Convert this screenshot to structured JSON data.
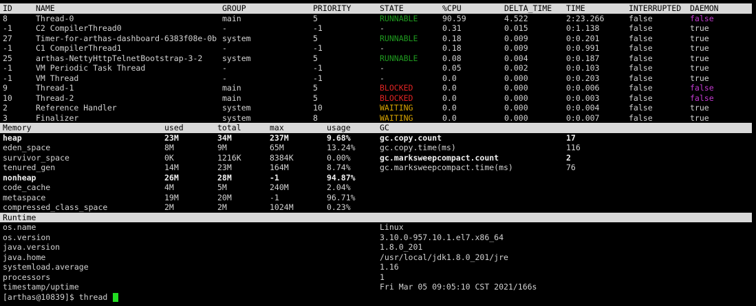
{
  "threads": {
    "columns": [
      "ID",
      "NAME",
      "GROUP",
      "PRIORITY",
      "STATE",
      "%CPU",
      "DELTA_TIME",
      "TIME",
      "INTERRUPTED",
      "DAEMON"
    ],
    "rows": [
      [
        "8",
        "Thread-0",
        "main",
        "5",
        "RUNNABLE",
        "90.59",
        "4.522",
        "2:23.266",
        "false",
        "false"
      ],
      [
        "-1",
        "C2 CompilerThread0",
        "-",
        "-1",
        "-",
        "0.31",
        "0.015",
        "0:1.138",
        "false",
        "true"
      ],
      [
        "27",
        "Timer-for-arthas-dashboard-6383f08e-0b",
        "system",
        "5",
        "RUNNABLE",
        "0.18",
        "0.009",
        "0:0.201",
        "false",
        "true"
      ],
      [
        "-1",
        "C1 CompilerThread1",
        "-",
        "-1",
        "-",
        "0.18",
        "0.009",
        "0:0.991",
        "false",
        "true"
      ],
      [
        "25",
        "arthas-NettyHttpTelnetBootstrap-3-2",
        "system",
        "5",
        "RUNNABLE",
        "0.08",
        "0.004",
        "0:0.187",
        "false",
        "true"
      ],
      [
        "-1",
        "VM Periodic Task Thread",
        "-",
        "-1",
        "-",
        "0.05",
        "0.002",
        "0:0.103",
        "false",
        "true"
      ],
      [
        "-1",
        "VM Thread",
        "-",
        "-1",
        "-",
        "0.0",
        "0.000",
        "0:0.203",
        "false",
        "true"
      ],
      [
        "9",
        "Thread-1",
        "main",
        "5",
        "BLOCKED",
        "0.0",
        "0.000",
        "0:0.006",
        "false",
        "false"
      ],
      [
        "10",
        "Thread-2",
        "main",
        "5",
        "BLOCKED",
        "0.0",
        "0.000",
        "0:0.003",
        "false",
        "false"
      ],
      [
        "2",
        "Reference Handler",
        "system",
        "10",
        "WAITING",
        "0.0",
        "0.000",
        "0:0.004",
        "false",
        "true"
      ],
      [
        "3",
        "Finalizer",
        "system",
        "8",
        "WAITING",
        "0.0",
        "0.000",
        "0:0.007",
        "false",
        "true"
      ]
    ]
  },
  "memory": {
    "columns": [
      "Memory",
      "used",
      "total",
      "max",
      "usage"
    ],
    "rows": [
      {
        "cells": [
          "heap",
          "23M",
          "34M",
          "237M",
          "9.68%"
        ],
        "bold": true
      },
      {
        "cells": [
          "eden_space",
          "8M",
          "9M",
          "65M",
          "13.24%"
        ],
        "bold": false
      },
      {
        "cells": [
          "survivor_space",
          "0K",
          "1216K",
          "8384K",
          "0.00%"
        ],
        "bold": false
      },
      {
        "cells": [
          "tenured_gen",
          "14M",
          "23M",
          "164M",
          "8.74%"
        ],
        "bold": false
      },
      {
        "cells": [
          "nonheap",
          "26M",
          "28M",
          "-1",
          "94.87%"
        ],
        "bold": true
      },
      {
        "cells": [
          "code_cache",
          "4M",
          "5M",
          "240M",
          "2.04%"
        ],
        "bold": false
      },
      {
        "cells": [
          "metaspace",
          "19M",
          "20M",
          "-1",
          "96.71%"
        ],
        "bold": false
      },
      {
        "cells": [
          "compressed_class_space",
          "2M",
          "2M",
          "1024M",
          "0.23%"
        ],
        "bold": false
      }
    ]
  },
  "gc": {
    "header": "GC",
    "rows": [
      {
        "name": "gc.copy.count",
        "value": "17",
        "bold": true
      },
      {
        "name": "gc.copy.time(ms)",
        "value": "116",
        "bold": false
      },
      {
        "name": "gc.marksweepcompact.count",
        "value": "2",
        "bold": true
      },
      {
        "name": "gc.marksweepcompact.time(ms)",
        "value": "76",
        "bold": false
      }
    ]
  },
  "runtime": {
    "header": "Runtime",
    "rows": [
      [
        "os.name",
        "Linux"
      ],
      [
        "os.version",
        "3.10.0-957.10.1.el7.x86_64"
      ],
      [
        "java.version",
        "1.8.0_201"
      ],
      [
        "java.home",
        "/usr/local/jdk1.8.0_201/jre"
      ],
      [
        "systemload.average",
        "1.16"
      ],
      [
        "processors",
        "1"
      ],
      [
        "timestamp/uptime",
        "Fri Mar 05 09:05:10 CST 2021/166s"
      ]
    ]
  },
  "prompt": {
    "text": "[arthas@10839]$ thread ",
    "cursor_color": "#22dd22"
  },
  "colors": {
    "header_bg": "#d9d9d9",
    "runnable": "#1f9a1f",
    "blocked": "#e02424",
    "waiting": "#d9a400",
    "daemon_false": "#c23bd0"
  }
}
